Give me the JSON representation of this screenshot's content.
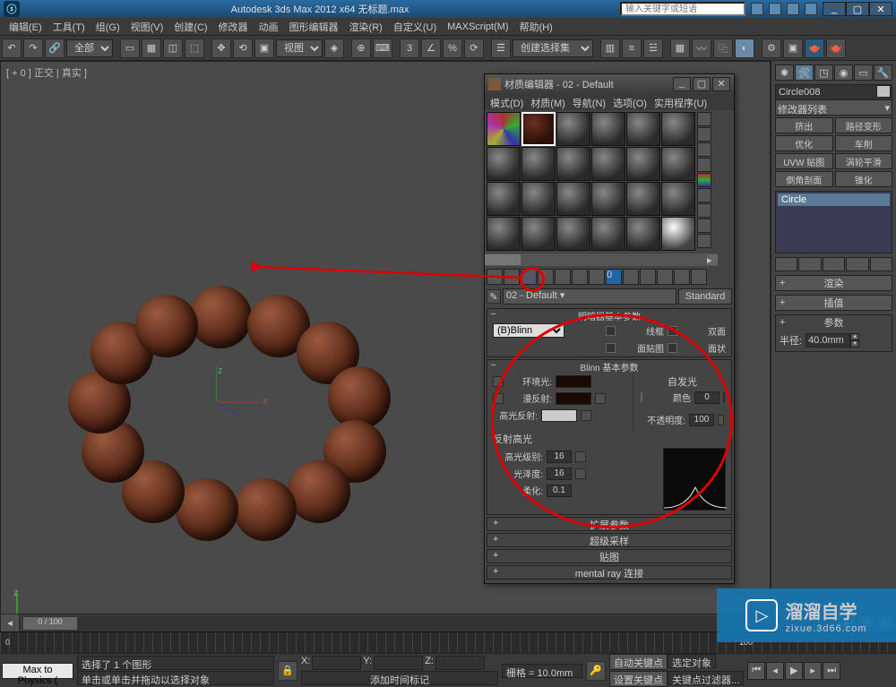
{
  "app": {
    "title": "Autodesk 3ds Max  2012 x64  无标题.max",
    "search_placeholder": "输入关键字或短语"
  },
  "menu": [
    "编辑(E)",
    "工具(T)",
    "组(G)",
    "视图(V)",
    "创建(C)",
    "修改器",
    "动画",
    "图形编辑器",
    "渲染(R)",
    "自定义(U)",
    "MAXScript(M)",
    "帮助(H)"
  ],
  "toolbar": {
    "obj_filter": "全部",
    "view_label": "视图",
    "selset": "创建选择集"
  },
  "viewport": {
    "label": "[ + 0 ] 正交 | 真实 ]"
  },
  "cmd": {
    "obj_name": "Circle008",
    "mod_list_label": "修改器列表",
    "buttons": [
      [
        "挤出",
        "路径变形"
      ],
      [
        "优化",
        "车削"
      ],
      [
        "UVW 贴图",
        "涡轮平滑"
      ],
      [
        "倒角剖面",
        "锥化"
      ]
    ],
    "stack_item": "Circle",
    "rollouts": [
      "渲染",
      "插值",
      "参数"
    ],
    "radius_label": "半径:",
    "radius_value": "40.0mm"
  },
  "mat": {
    "title": "材质编辑器 - 02 - Default",
    "menu": [
      "模式(D)",
      "材质(M)",
      "导航(N)",
      "选项(O)",
      "实用程序(U)"
    ],
    "name": "02 - Default",
    "type_btn": "Standard",
    "shader_sec": "明暗器基本参数",
    "shader": "(B)Blinn",
    "shader_opts": {
      "wire": "线框",
      "two": "双面",
      "facemap": "面贴图",
      "faceted": "面状"
    },
    "blinn_sec": "Blinn 基本参数",
    "selfillum": "自发光",
    "color_lbl": "颜色",
    "color_val": "0",
    "ambient": "环境光:",
    "diffuse": "漫反射:",
    "specular": "高光反射:",
    "opacity": "不透明度:",
    "opacity_val": "100",
    "spec_sec": "反射高光",
    "spec_level": "高光级别:",
    "spec_level_val": "16",
    "gloss": "光泽度:",
    "gloss_val": "16",
    "soften": "柔化:",
    "soften_val": "0.1",
    "exp": [
      "扩展参数",
      "超级采样",
      "贴图",
      "mental ray 连接"
    ]
  },
  "bottom": {
    "frame": "0 / 100",
    "script_btn": "Max to Physics (",
    "sel": "选择了 1 个图形",
    "hint": "单击或单击并拖动以选择对象",
    "add_marker": "添加时间标记",
    "x": "X:",
    "y": "Y:",
    "z": "Z:",
    "grid": "栅格 = 10.0mm",
    "autokey": "自动关键点",
    "selkey": "选定对象",
    "setkey": "设置关键点",
    "keyfilter": "关键点过滤器..."
  },
  "watermark": {
    "cn": "溜溜自学",
    "en": "zixue.3d66.com"
  }
}
